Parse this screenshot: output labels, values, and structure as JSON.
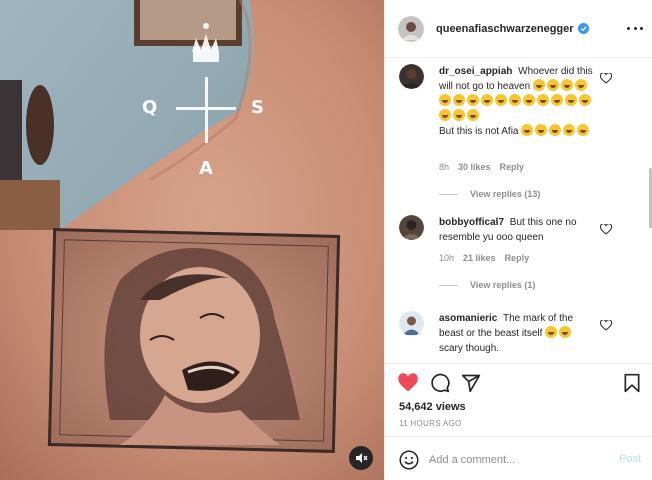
{
  "post": {
    "username": "queenafiaschwarzenegger",
    "verified": true,
    "views": "54,642 views",
    "time": "11 HOURS AGO"
  },
  "overlay": {
    "left_letter": "Q",
    "right_letter": "S",
    "bottom_letter": "A"
  },
  "comments": [
    {
      "user": "dr_osei_appiah",
      "text_1": "Whoever did this will not go to heaven",
      "emojis_1": 18,
      "text_2": "But this is not Afia",
      "emojis_2": 5,
      "age": "8h",
      "likes": "30 likes",
      "reply": "Reply",
      "view_replies": "View replies (13)"
    },
    {
      "user": "bobbyoffical7",
      "text_1": "But this one no resemble yu ooo queen",
      "age": "10h",
      "likes": "21 likes",
      "reply": "Reply",
      "view_replies": "View replies (1)"
    },
    {
      "user": "asomanieric",
      "text_1": "The mark of the beast or the beast itself",
      "emojis_1": 2,
      "text_2": "scary though."
    }
  ],
  "add_comment": {
    "placeholder": "Add a comment...",
    "post_label": "Post"
  },
  "colors": {
    "like_red": "#ed4956",
    "verified_blue": "#3897f0",
    "post_disabled": "#b2dffc"
  },
  "icons": [
    "heart-icon",
    "comment-icon",
    "share-icon",
    "bookmark-icon",
    "emoji-icon",
    "more-icon",
    "mute-icon",
    "crown-icon"
  ]
}
